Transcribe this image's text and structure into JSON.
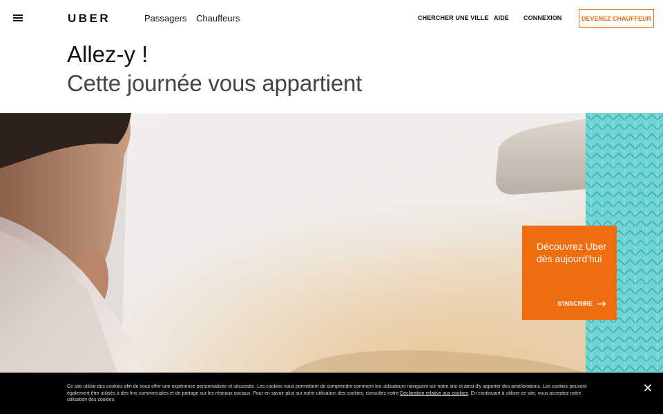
{
  "header": {
    "logo": "UBER",
    "nav_main": [
      "Passagers",
      "Chauffeurs"
    ],
    "nav_right": [
      "CHERCHER UNE VILLE",
      "AIDE",
      "CONNEXION"
    ],
    "cta": "DEVENEZ CHAUFFEUR"
  },
  "hero": {
    "title_line1": "Allez-y !",
    "title_line2": "Cette journée vous appartient"
  },
  "promo": {
    "text": "Découvrez Uber dès aujourd'hui",
    "link": "S'INSCRIRE"
  },
  "cookie": {
    "text_before": "Ce site utilise des cookies afin de vous offrir une expérience personnalisée et sécurisée. Les cookies nous permettent de comprendre comment les utilisateurs naviguent sur notre site et ainsi d'y apporter des améliorations. Les cookies peuvent également être utilisés à des fins commerciales et de partage sur les réseaux sociaux. Pour en savoir plus sur notre utilisation des cookies, consultez notre ",
    "link": "Déclaration relative aux cookies",
    "text_after": ". En continuant à utiliser ce site, vous acceptez notre utilisation des cookies."
  },
  "colors": {
    "accent": "#ef6c0f",
    "pattern_bg": "#6fd4d2",
    "cookie_bg": "#000000"
  },
  "icons": [
    "menu-icon",
    "arrow-right-icon",
    "close-icon"
  ]
}
